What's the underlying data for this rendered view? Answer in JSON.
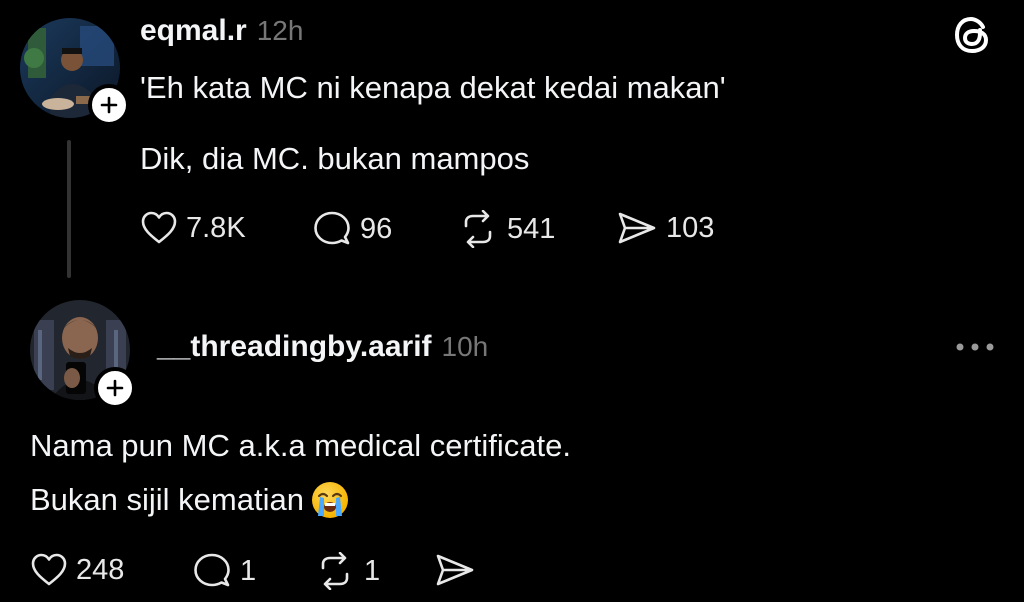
{
  "post1": {
    "username": "eqmal.r",
    "time": "12h",
    "line1": "'Eh kata MC ni kenapa dekat kedai makan'",
    "line2": "Dik, dia MC. bukan mampos",
    "likes": "7.8K",
    "comments": "96",
    "reposts": "541",
    "shares": "103"
  },
  "post2": {
    "username": "__threadingby.aarif",
    "time": "10h",
    "line1": "Nama pun MC a.k.a medical certificate.",
    "line2": "Bukan sijil kematian",
    "likes": "248",
    "comments": "1",
    "reposts": "1"
  },
  "icons": {
    "logo": "threads-logo-icon",
    "like": "heart-icon",
    "comment": "comment-bubble-icon",
    "repost": "repost-icon",
    "share": "send-icon",
    "more": "more-dots-icon",
    "follow": "plus-icon",
    "emoji": "loudly-crying-face-emoji"
  },
  "colors": {
    "background": "#000000",
    "text": "#f3f5f7",
    "muted": "#777777"
  }
}
